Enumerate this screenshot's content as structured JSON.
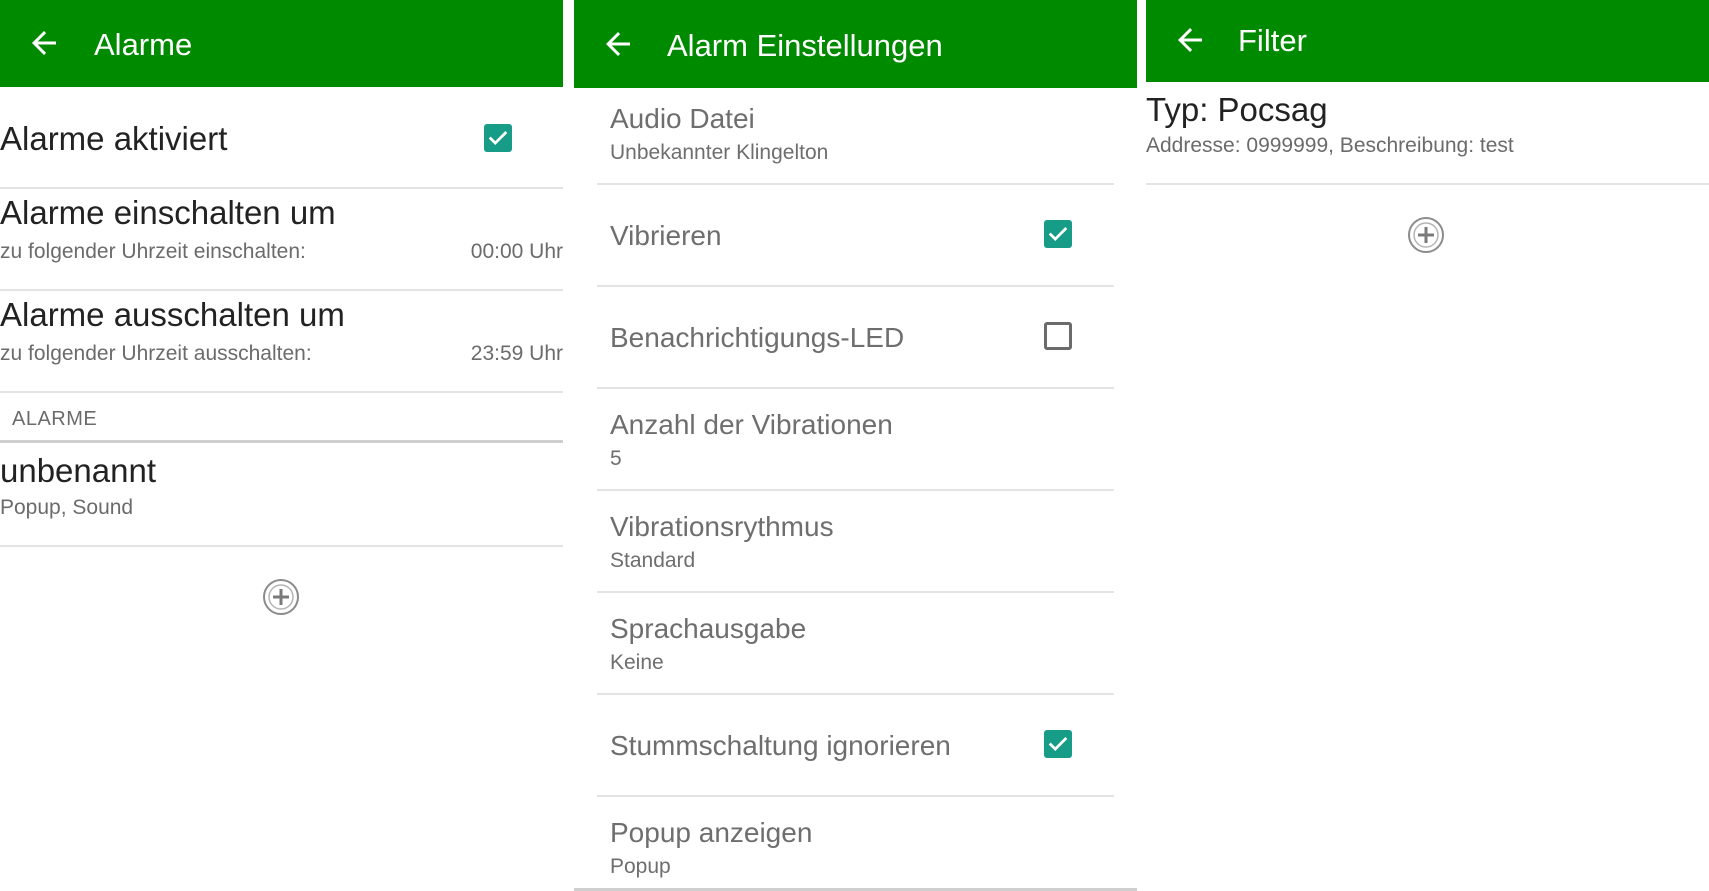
{
  "screens": [
    {
      "title": "Alarme",
      "rows": [
        {
          "label": "Alarme aktiviert",
          "checked": true
        },
        {
          "label": "Alarme einschalten um",
          "sub": "zu folgender Uhrzeit einschalten:",
          "value": "00:00 Uhr"
        },
        {
          "label": "Alarme ausschalten um",
          "sub": "zu folgender Uhrzeit ausschalten:",
          "value": "23:59 Uhr"
        }
      ],
      "section_header": "ALARME",
      "alarms": [
        {
          "name": "unbenannt",
          "detail": "Popup, Sound"
        }
      ]
    },
    {
      "title": "Alarm Einstellungen",
      "rows": [
        {
          "label": "Audio Datei",
          "sub": "Unbekannter Klingelton"
        },
        {
          "label": "Vibrieren",
          "checked": true
        },
        {
          "label": "Benachrichtigungs-LED",
          "checked": false
        },
        {
          "label": "Anzahl der Vibrationen",
          "sub": "5"
        },
        {
          "label": "Vibrationsrythmus",
          "sub": "Standard"
        },
        {
          "label": "Sprachausgabe",
          "sub": "Keine"
        },
        {
          "label": "Stummschaltung ignorieren",
          "checked": true
        },
        {
          "label": "Popup anzeigen",
          "sub": "Popup"
        }
      ]
    },
    {
      "title": "Filter",
      "filters": [
        {
          "type": "Typ: Pocsag",
          "detail": "Addresse: 0999999, Beschreibung: test"
        }
      ]
    }
  ],
  "icons": {
    "back": "arrow-left-icon",
    "add": "add-circle-icon",
    "check": "checkbox-checked-icon"
  },
  "colors": {
    "appbar": "#008a00",
    "checkbox": "#169c87",
    "text_secondary": "#6b6b6b"
  }
}
